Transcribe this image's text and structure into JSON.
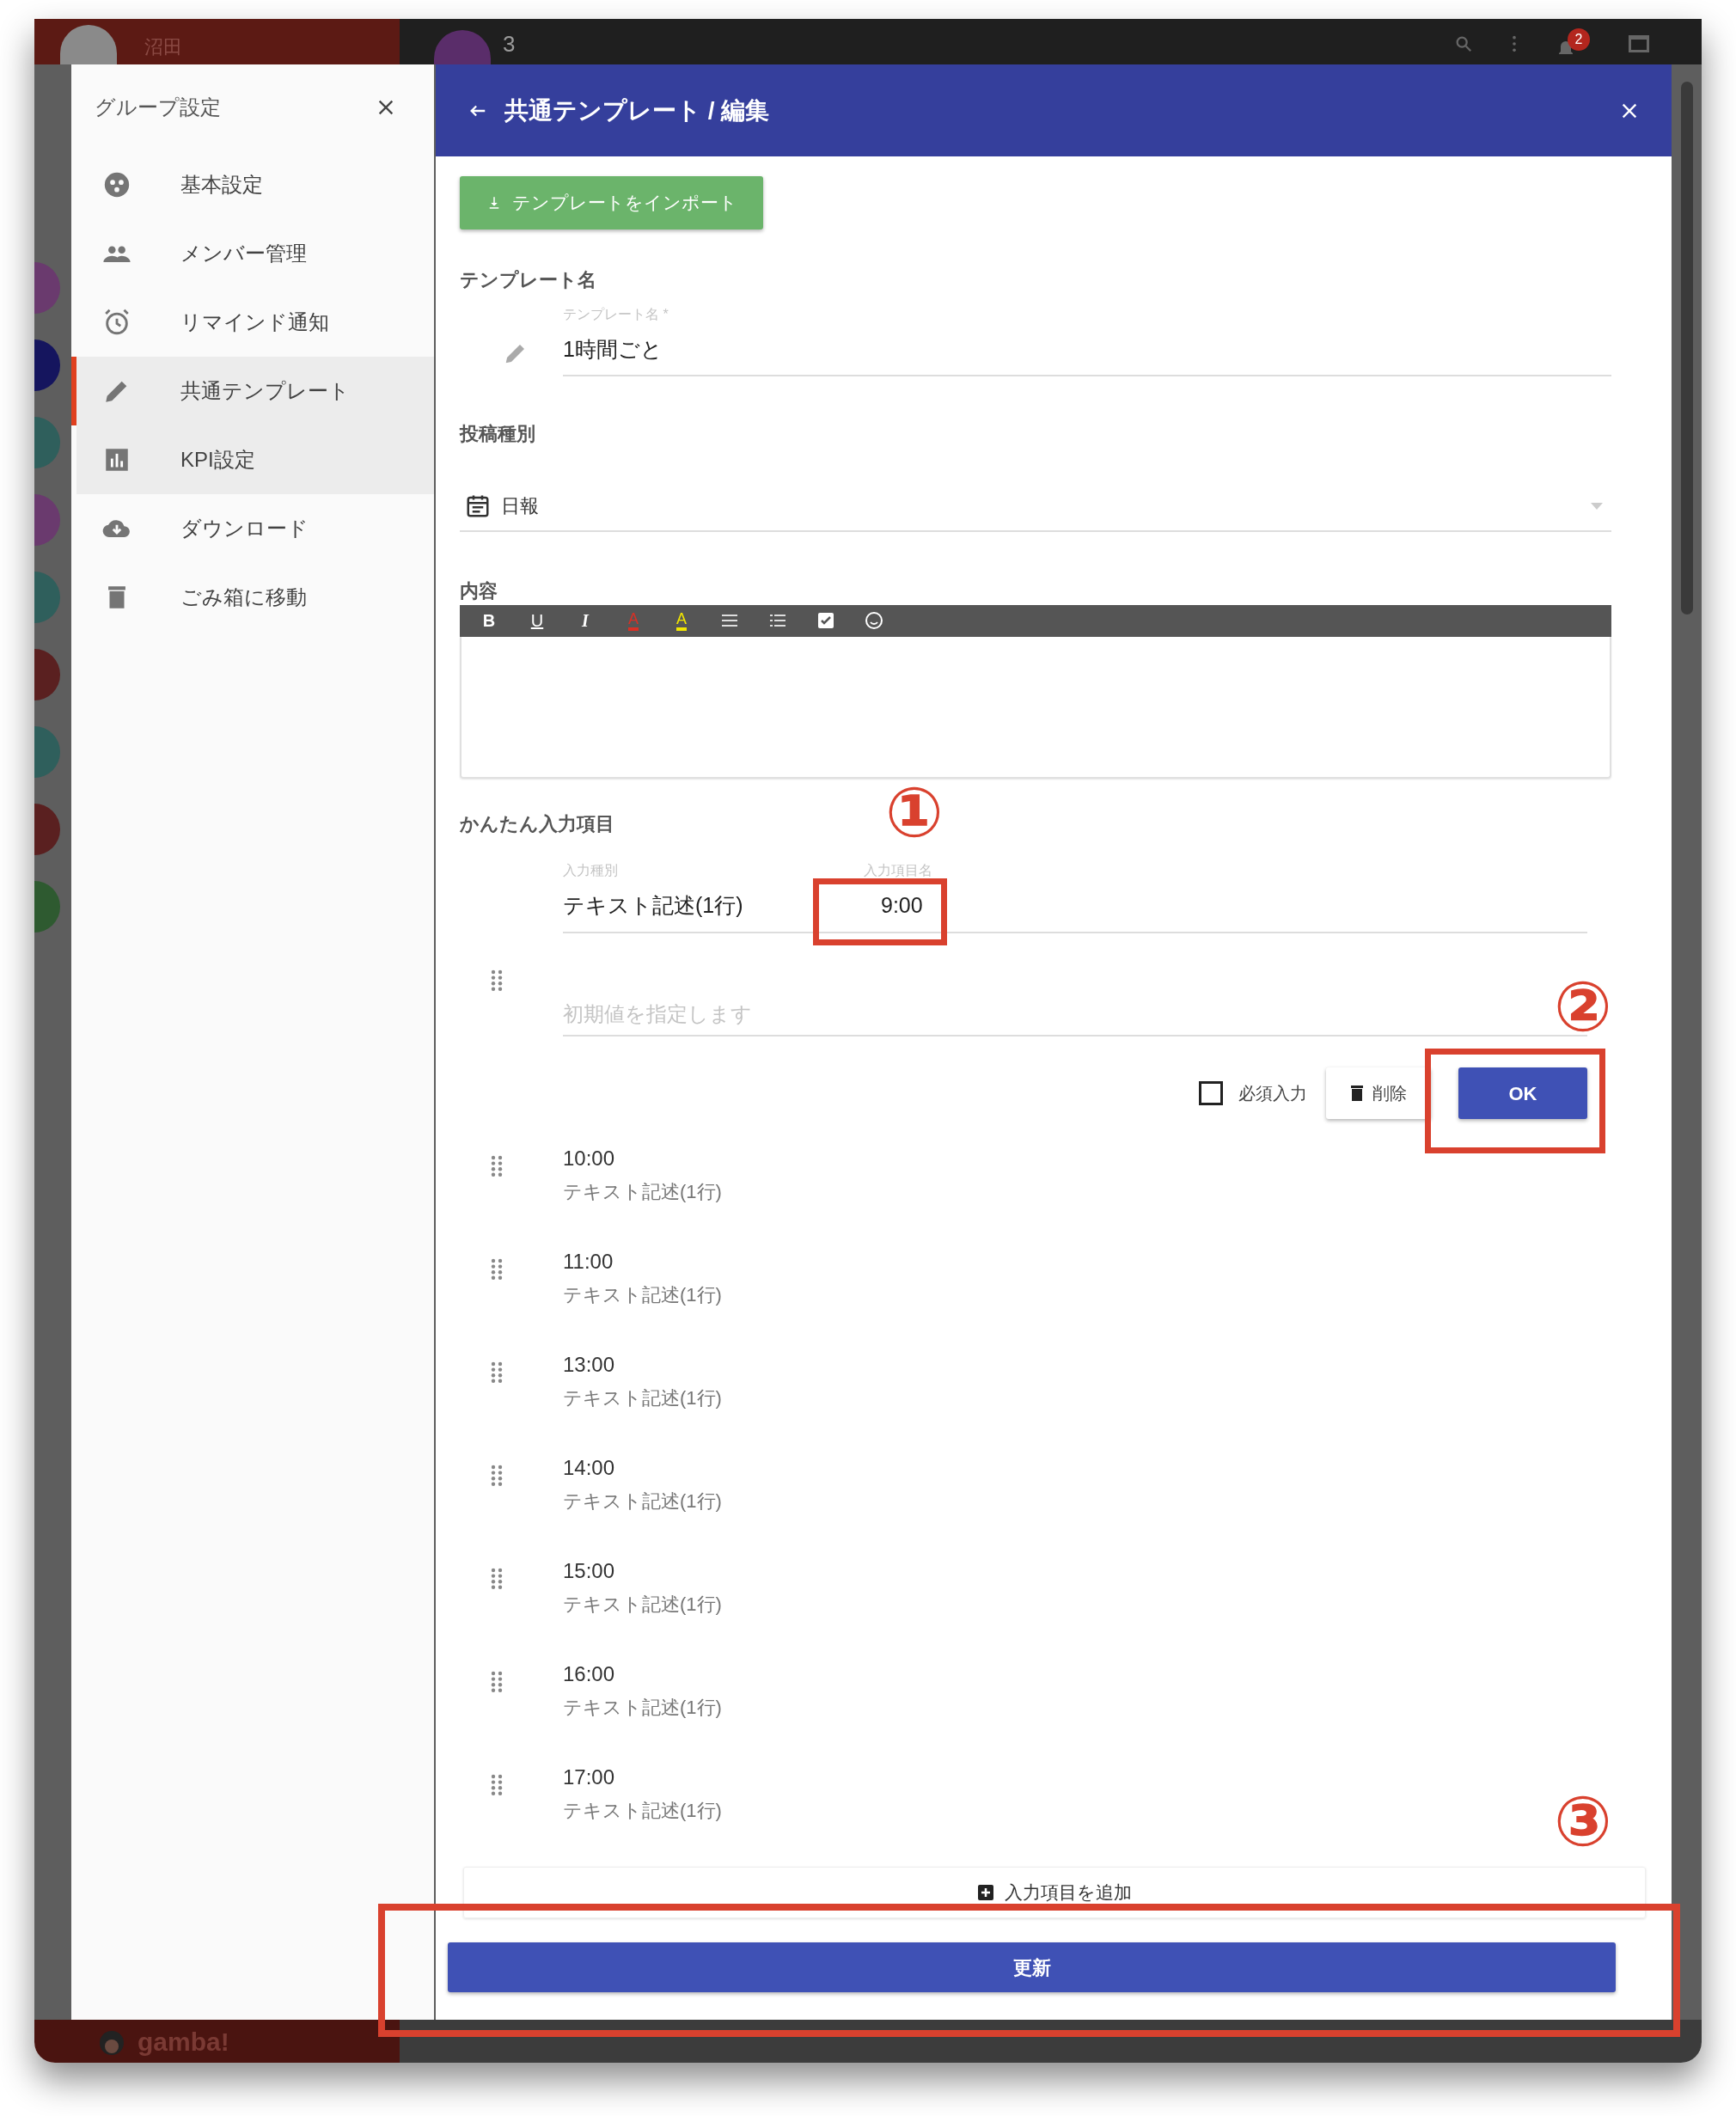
{
  "app_bar": {
    "user_name": "沼田",
    "group_count": "3",
    "notification_badge": "2"
  },
  "drawer": {
    "title": "グループ設定",
    "items": [
      {
        "label": "基本設定",
        "selected": false,
        "highlighted": false
      },
      {
        "label": "メンバー管理",
        "selected": false,
        "highlighted": false
      },
      {
        "label": "リマインド通知",
        "selected": false,
        "highlighted": false
      },
      {
        "label": "共通テンプレート",
        "selected": true,
        "highlighted": true
      },
      {
        "label": "KPI設定",
        "selected": false,
        "highlighted": true
      },
      {
        "label": "ダウンロード",
        "selected": false,
        "highlighted": false
      },
      {
        "label": "ごみ箱に移動",
        "selected": false,
        "highlighted": false
      }
    ]
  },
  "dialog": {
    "title": "共通テンプレート / 編集",
    "import_button": "テンプレートをインポート",
    "name_section": {
      "heading": "テンプレート名",
      "field_label": "テンプレート名 *",
      "value": "1時間ごと"
    },
    "post_type": {
      "heading": "投稿種別",
      "value": "日報"
    },
    "content": {
      "heading": "内容",
      "toolbar": [
        {
          "kind": "bold",
          "label": "B"
        },
        {
          "kind": "underline",
          "label": "U"
        },
        {
          "kind": "italic",
          "label": "I"
        },
        {
          "kind": "color",
          "label": "A",
          "color": "#d93025"
        },
        {
          "kind": "color",
          "label": "A",
          "color": "#f2e600"
        },
        {
          "kind": "bullets"
        },
        {
          "kind": "numbers"
        },
        {
          "kind": "checkbox"
        },
        {
          "kind": "emoji"
        }
      ]
    },
    "quick_items": {
      "heading": "かんたん入力項目",
      "editing": {
        "type_label": "入力種別",
        "type_value": "テキスト記述(1行)",
        "name_label": "入力項目名",
        "name_value": "9:00",
        "default_placeholder": "初期値を指定します",
        "required_label": "必須入力",
        "required_checked": false,
        "delete_button": "削除",
        "ok_button": "OK"
      },
      "items": [
        {
          "name": "10:00",
          "type": "テキスト記述(1行)"
        },
        {
          "name": "11:00",
          "type": "テキスト記述(1行)"
        },
        {
          "name": "13:00",
          "type": "テキスト記述(1行)"
        },
        {
          "name": "14:00",
          "type": "テキスト記述(1行)"
        },
        {
          "name": "15:00",
          "type": "テキスト記述(1行)"
        },
        {
          "name": "16:00",
          "type": "テキスト記述(1行)"
        },
        {
          "name": "17:00",
          "type": "テキスト記述(1行)"
        }
      ],
      "add_button": "入力項目を追加"
    },
    "update_button": "更新"
  },
  "footer_logo": "gamba!",
  "annotations": [
    {
      "label": "①"
    },
    {
      "label": "②"
    },
    {
      "label": "③"
    }
  ]
}
